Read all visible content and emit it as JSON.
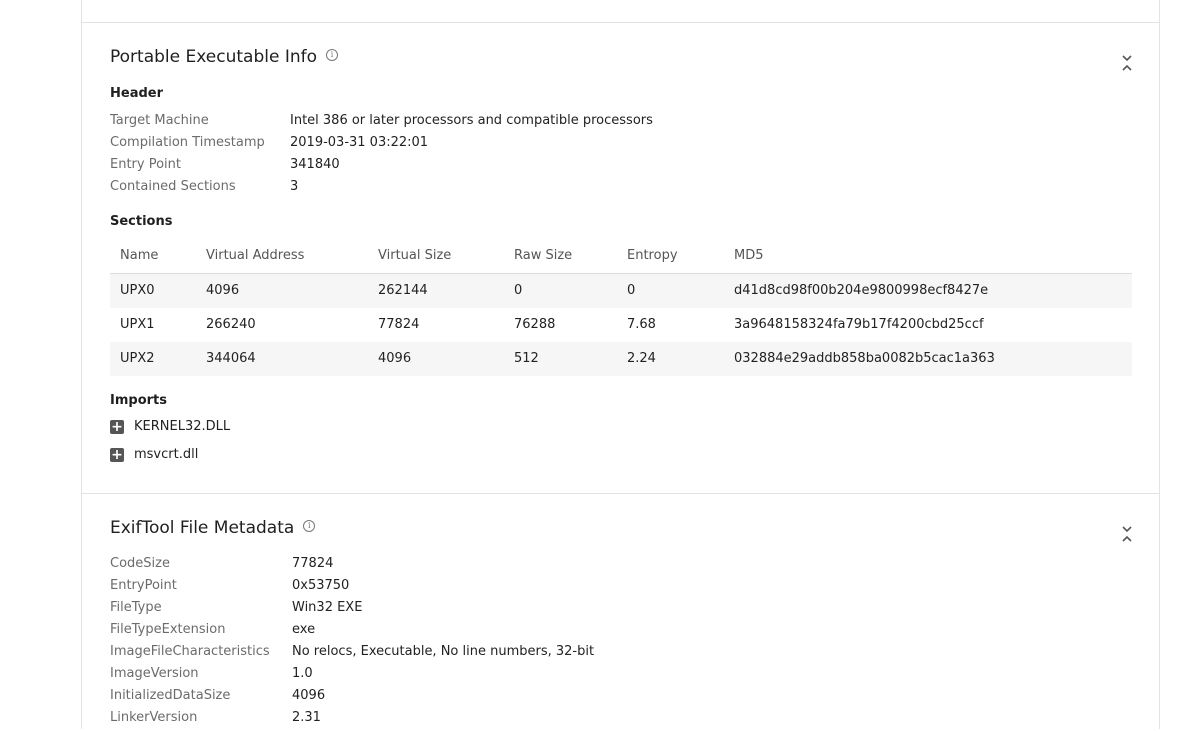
{
  "pe_info": {
    "title": "Portable Executable Info",
    "header_heading": "Header",
    "header_rows": [
      {
        "key": "Target Machine",
        "value": "Intel 386 or later processors and compatible processors"
      },
      {
        "key": "Compilation Timestamp",
        "value": "2019-03-31 03:22:01"
      },
      {
        "key": "Entry Point",
        "value": "341840"
      },
      {
        "key": "Contained Sections",
        "value": "3"
      }
    ],
    "sections_heading": "Sections",
    "sections_columns": [
      "Name",
      "Virtual Address",
      "Virtual Size",
      "Raw Size",
      "Entropy",
      "MD5"
    ],
    "sections_rows": [
      [
        "UPX0",
        "4096",
        "262144",
        "0",
        "0",
        "d41d8cd98f00b204e9800998ecf8427e"
      ],
      [
        "UPX1",
        "266240",
        "77824",
        "76288",
        "7.68",
        "3a9648158324fa79b17f4200cbd25ccf"
      ],
      [
        "UPX2",
        "344064",
        "4096",
        "512",
        "2.24",
        "032884e29addb858ba0082b5cac1a363"
      ]
    ],
    "imports_heading": "Imports",
    "imports": [
      "KERNEL32.DLL",
      "msvcrt.dll"
    ]
  },
  "exif": {
    "title": "ExifTool File Metadata",
    "rows": [
      {
        "key": "CodeSize",
        "value": "77824"
      },
      {
        "key": "EntryPoint",
        "value": "0x53750"
      },
      {
        "key": "FileType",
        "value": "Win32 EXE"
      },
      {
        "key": "FileTypeExtension",
        "value": "exe"
      },
      {
        "key": "ImageFileCharacteristics",
        "value": "No relocs, Executable, No line numbers, 32-bit"
      },
      {
        "key": "ImageVersion",
        "value": "1.0"
      },
      {
        "key": "InitializedDataSize",
        "value": "4096"
      },
      {
        "key": "LinkerVersion",
        "value": "2.31"
      }
    ]
  },
  "icons": {
    "info": "info-icon",
    "collapse": "chevron-collapse-icon",
    "expand": "plus-box-icon"
  },
  "colors": {
    "border": "#e3e3e3",
    "alt_row": "#f6f6f6",
    "key_text": "#6b6b6b"
  }
}
